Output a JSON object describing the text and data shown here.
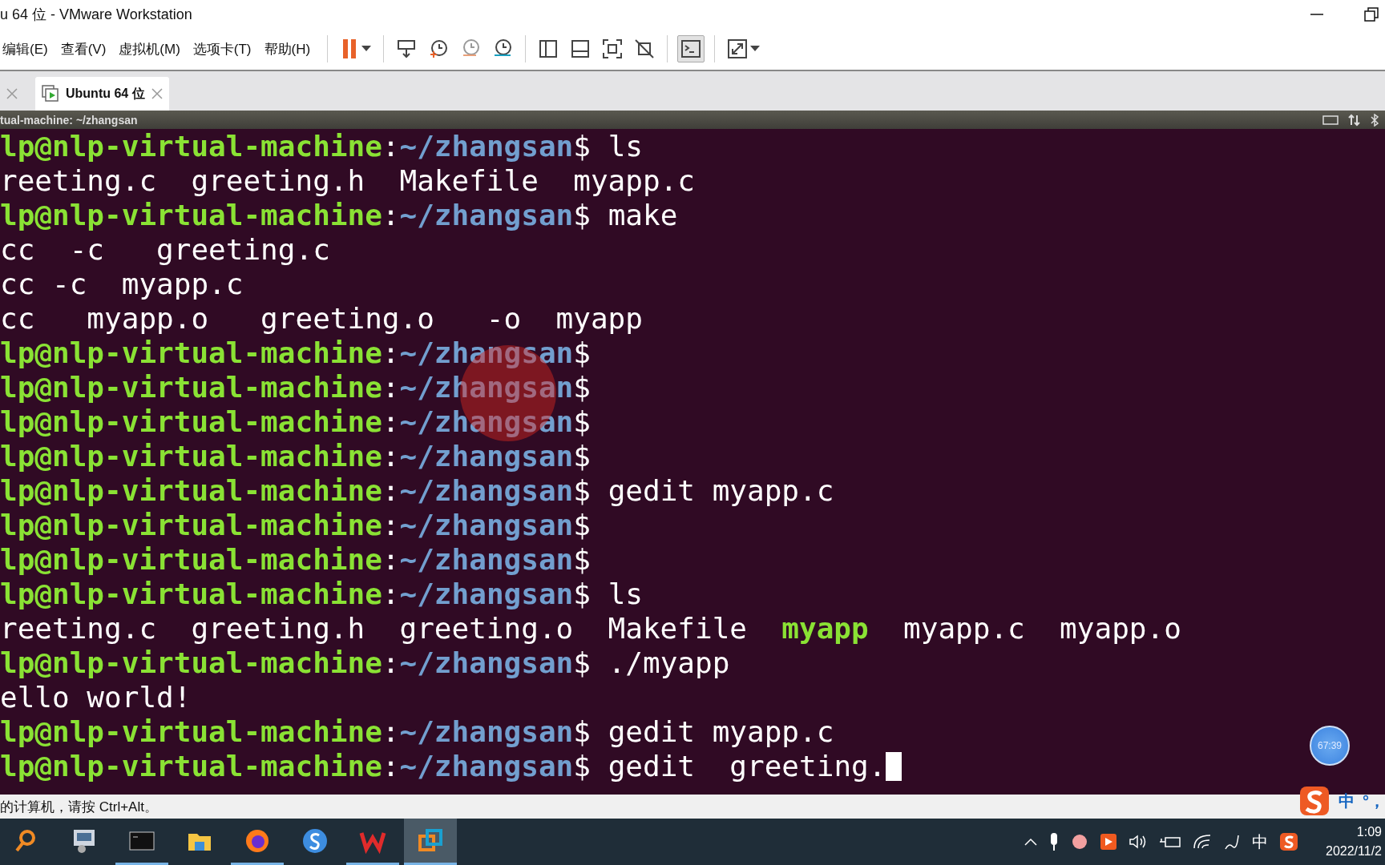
{
  "window": {
    "title": "u 64 位 - VMware Workstation"
  },
  "menu": [
    "编辑(E)",
    "查看(V)",
    "虚拟机(M)",
    "选项卡(T)",
    "帮助(H)"
  ],
  "tabs": [
    {
      "selected": false
    },
    {
      "label": "Ubuntu 64 位",
      "selected": true
    }
  ],
  "vm_bar": {
    "title": "tual-machine: ~/zhangsan"
  },
  "terminal": {
    "separator": ":",
    "prompt_sign": "$",
    "lines": [
      {
        "kind": "prompt",
        "user": "lp@nlp-virtual-machine",
        "path": "~/zhangsan",
        "command": "ls"
      },
      {
        "kind": "output",
        "segments": [
          {
            "text": "reeting.c  greeting.h  Makefile  myapp.c",
            "executable": false
          }
        ]
      },
      {
        "kind": "prompt",
        "user": "lp@nlp-virtual-machine",
        "path": "~/zhangsan",
        "command": "make"
      },
      {
        "kind": "output",
        "segments": [
          {
            "text": "cc  -c   greeting.c",
            "executable": false
          }
        ]
      },
      {
        "kind": "output",
        "segments": [
          {
            "text": "cc -c  myapp.c",
            "executable": false
          }
        ]
      },
      {
        "kind": "output",
        "segments": [
          {
            "text": "cc   myapp.o   greeting.o   -o  myapp",
            "executable": false
          }
        ]
      },
      {
        "kind": "prompt",
        "user": "lp@nlp-virtual-machine",
        "path": "~/zhangsan"
      },
      {
        "kind": "prompt",
        "user": "lp@nlp-virtual-machine",
        "path": "~/zhangsan"
      },
      {
        "kind": "prompt",
        "user": "lp@nlp-virtual-machine",
        "path": "~/zhangsan"
      },
      {
        "kind": "prompt",
        "user": "lp@nlp-virtual-machine",
        "path": "~/zhangsan"
      },
      {
        "kind": "prompt",
        "user": "lp@nlp-virtual-machine",
        "path": "~/zhangsan",
        "command": "gedit myapp.c"
      },
      {
        "kind": "prompt",
        "user": "lp@nlp-virtual-machine",
        "path": "~/zhangsan"
      },
      {
        "kind": "prompt",
        "user": "lp@nlp-virtual-machine",
        "path": "~/zhangsan"
      },
      {
        "kind": "prompt",
        "user": "lp@nlp-virtual-machine",
        "path": "~/zhangsan",
        "command": "ls"
      },
      {
        "kind": "output",
        "segments": [
          {
            "text": "reeting.c  greeting.h  greeting.o  Makefile  ",
            "executable": false
          },
          {
            "text": "myapp",
            "executable": true
          },
          {
            "text": "  myapp.c  myapp.o",
            "executable": false
          }
        ]
      },
      {
        "kind": "prompt",
        "user": "lp@nlp-virtual-machine",
        "path": "~/zhangsan",
        "command": "./myapp"
      },
      {
        "kind": "output",
        "segments": [
          {
            "text": "ello world!",
            "executable": false
          }
        ]
      },
      {
        "kind": "prompt",
        "user": "lp@nlp-virtual-machine",
        "path": "~/zhangsan",
        "command": "gedit myapp.c"
      },
      {
        "kind": "prompt",
        "user": "lp@nlp-virtual-machine",
        "path": "~/zhangsan",
        "command": "gedit  greeting.",
        "cursor": true
      }
    ]
  },
  "timer": "67:39",
  "status_bar": {
    "text": "的计算机，请按 Ctrl+Alt。"
  },
  "ime": {
    "mode": "中",
    "punct": "°，"
  },
  "taskbar": {
    "apps": [
      {
        "kind": "search",
        "running": false,
        "selected": false
      },
      {
        "kind": "security",
        "running": false,
        "selected": false
      },
      {
        "kind": "terminal",
        "running": true,
        "selected": false
      },
      {
        "kind": "folder",
        "running": false,
        "selected": false
      },
      {
        "kind": "browser",
        "running": true,
        "selected": false
      },
      {
        "kind": "sogou",
        "running": false,
        "selected": false
      },
      {
        "kind": "wps",
        "running": true,
        "selected": false
      },
      {
        "kind": "vmware",
        "running": true,
        "selected": true
      }
    ],
    "input_mode": "中",
    "time": "1:09",
    "date": "2022/11/2"
  }
}
